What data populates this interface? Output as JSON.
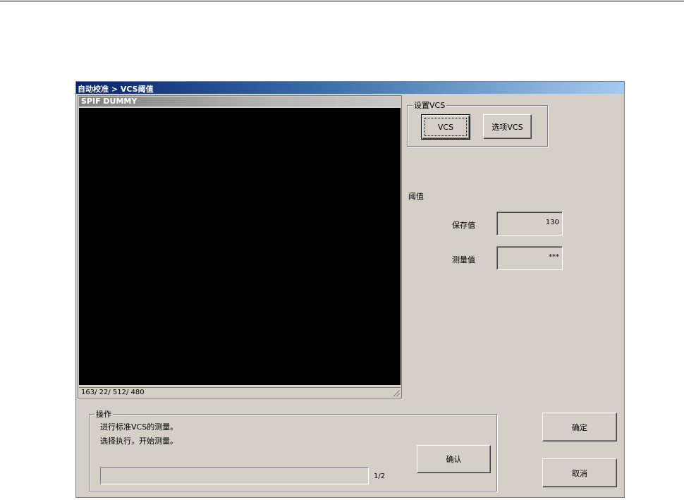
{
  "window": {
    "title": "自动校准 > VCS阈值"
  },
  "view": {
    "caption": "SPIF DUMMY",
    "status": "163/ 22/ 512/ 480"
  },
  "vcs_group": {
    "legend": "设置VCS",
    "vcs_button": "VCS",
    "option_vcs_button": "选项VCS"
  },
  "threshold": {
    "heading": "阈值",
    "saved_label": "保存值",
    "saved_value": "130",
    "measured_label": "测量值",
    "measured_value": "***"
  },
  "operation": {
    "legend": "操作",
    "line1": "进行标准VCS的测量。",
    "line2": "选择执行，开始测量。",
    "confirm_button": "确认",
    "progress_fraction": 0,
    "step": "1/2"
  },
  "dialog": {
    "ok_button": "确定",
    "cancel_button": "取消"
  },
  "colors": {
    "face": "#d4d0c8",
    "title_start": "#0a246a",
    "screen": "#000000"
  },
  "icons": [
    "size-grip-icon"
  ]
}
